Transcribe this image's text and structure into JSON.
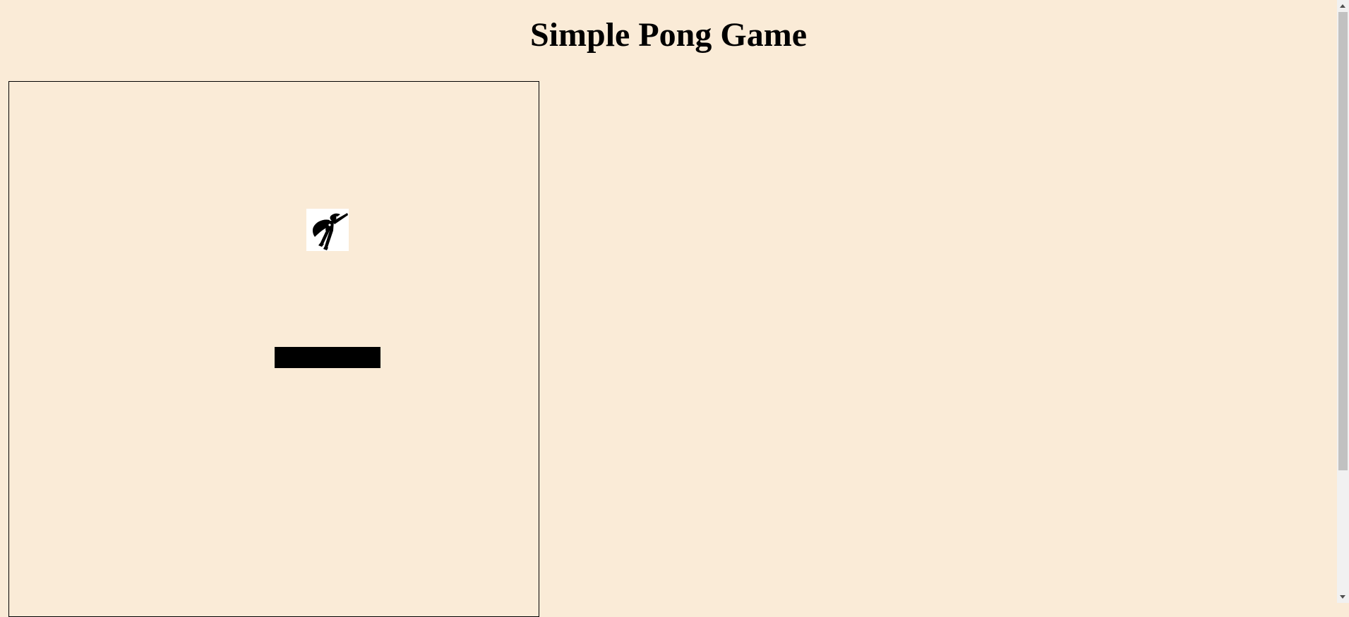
{
  "page": {
    "title": "Simple Pong Game",
    "background_color": "#faebd7"
  },
  "game": {
    "ball": {
      "icon": "superhero-icon",
      "background_color": "#ffffff"
    },
    "paddle": {
      "color": "#000000"
    },
    "board_border_color": "#000000"
  }
}
